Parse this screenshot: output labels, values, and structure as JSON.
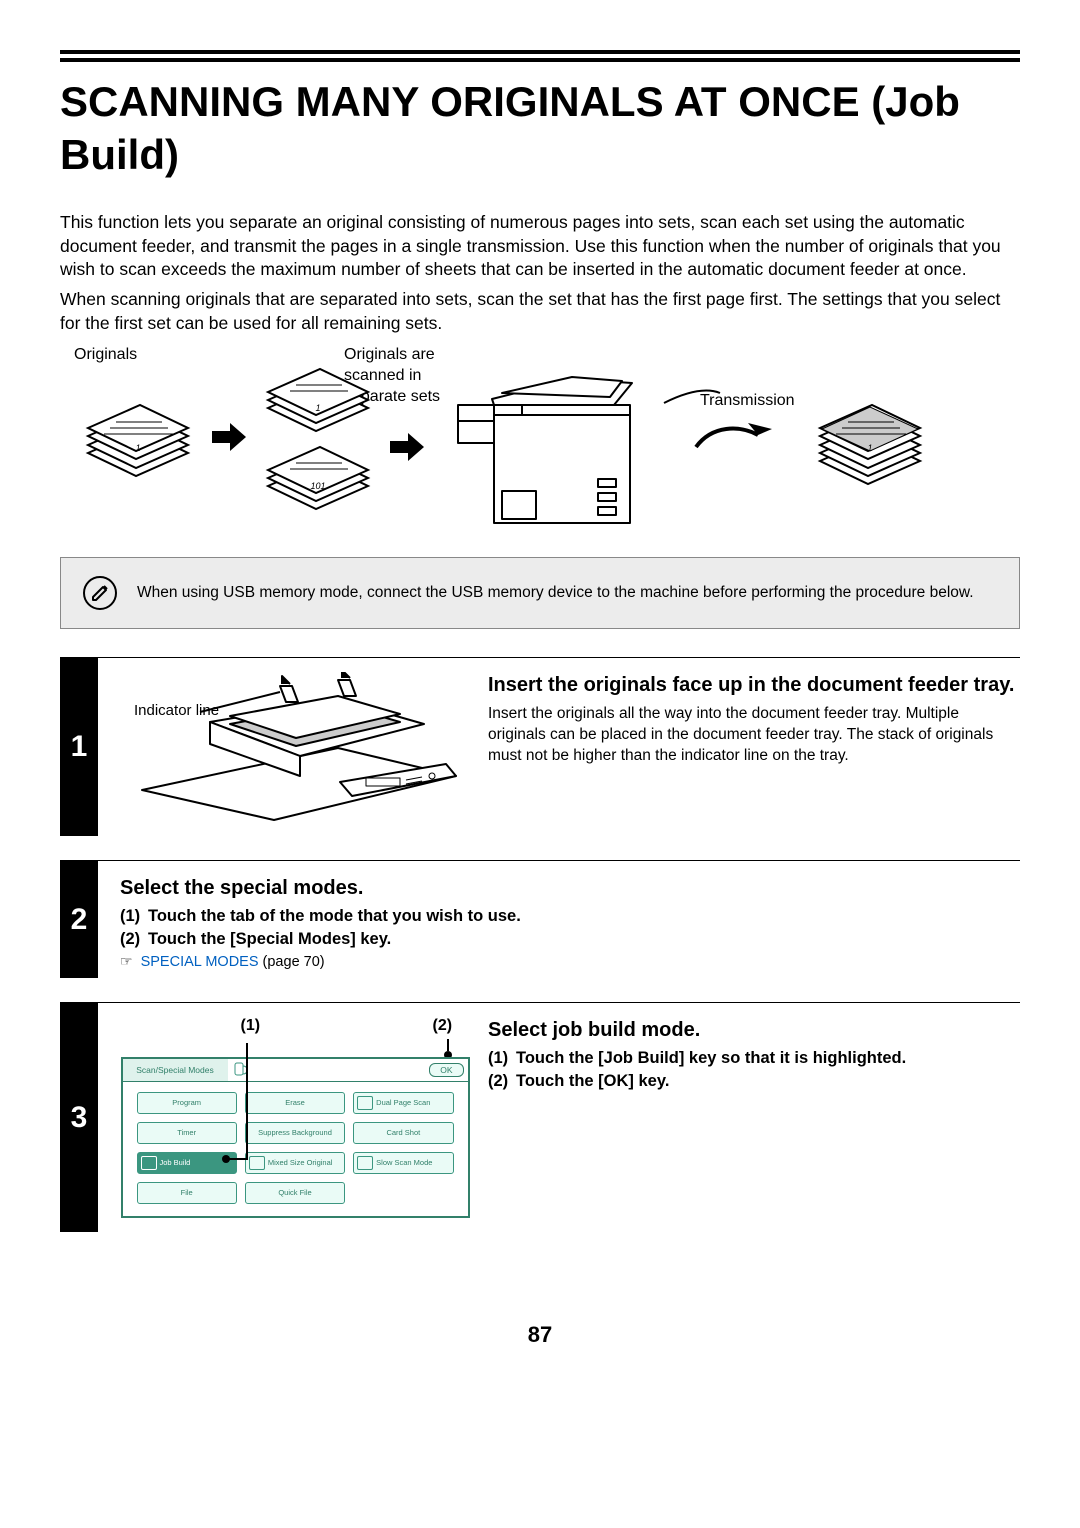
{
  "title": "SCANNING MANY ORIGINALS AT ONCE (Job Build)",
  "intro_p1": "This function lets you separate an original consisting of numerous pages into sets, scan each set using the automatic document feeder, and transmit the pages in a single transmission. Use this function when the number of originals that you wish to scan exceeds the maximum number of sheets that can be inserted in the automatic document feeder at once.",
  "intro_p2": "When scanning originals that are separated into sets, scan the set that has the first page first. The settings that you select for the first set can be used for all remaining sets.",
  "flow": {
    "originals_label": "Originals",
    "scanned_label": "Originals are scanned in separate sets",
    "transmission_label": "Transmission"
  },
  "note": "When using USB memory mode, connect the USB memory device to the machine before performing the procedure below.",
  "step1": {
    "num": "1",
    "indicator_label": "Indicator line",
    "heading": "Insert the originals face up in the document feeder tray.",
    "body": "Insert the originals all the way into the document feeder tray. Multiple originals can be placed in the document feeder tray. The stack of originals must not be higher than the indicator line on the tray."
  },
  "step2": {
    "num": "2",
    "heading": "Select the special modes.",
    "sub1_no": "(1)",
    "sub1": "Touch the tab of the mode that you wish to use.",
    "sub2_no": "(2)",
    "sub2": "Touch the [Special Modes] key.",
    "link_icon": "☞",
    "link_text": "SPECIAL MODES",
    "link_page": " (page 70)"
  },
  "step3": {
    "num": "3",
    "marker1": "(1)",
    "marker2": "(2)",
    "panel_title": "Scan/Special Modes",
    "ok": "OK",
    "buttons": {
      "program": "Program",
      "erase": "Erase",
      "dualpage": "Dual Page Scan",
      "timer": "Timer",
      "suppress": "Suppress Background",
      "cardshot": "Card Shot",
      "jobbuild": "Job Build",
      "mixed": "Mixed Size Original",
      "slowscan": "Slow Scan Mode",
      "file": "File",
      "quickfile": "Quick File"
    },
    "heading": "Select job build mode.",
    "sub1_no": "(1)",
    "sub1": "Touch the [Job Build] key so that it is highlighted.",
    "sub2_no": "(2)",
    "sub2": "Touch the [OK] key."
  },
  "page_number": "87"
}
